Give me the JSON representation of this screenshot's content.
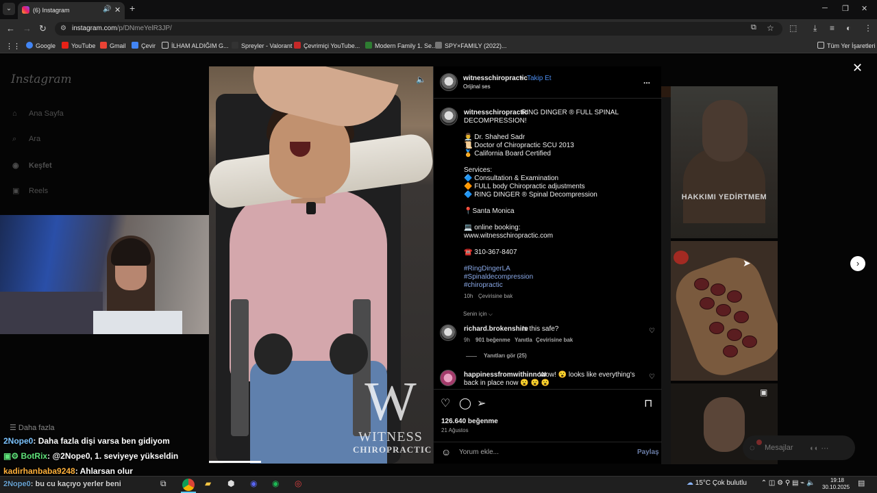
{
  "browser": {
    "tab_title": "(6) Instagram",
    "new_tab": "+",
    "url_host": "instagram.com",
    "url_path": "/p/DNmeYelR3JP/",
    "bookmarks": [
      "Google",
      "YouTube",
      "Gmail",
      "Çevir",
      "İLHAM ALDIĞIM G...",
      "Spreyler - Valorant",
      "Çevrimiçi YouTube...",
      "Modern Family 1. Se...",
      "SPY×FAMILY (2022)..."
    ],
    "all_bookmarks": "Tüm Yer İşaretleri"
  },
  "instagram": {
    "logo": "Instagram",
    "nav": [
      "Ana Sayfa",
      "Ara",
      "Keşfet",
      "Reels",
      "Mesajlar",
      "Daha fazla"
    ],
    "thumb_text": "HAKKIMI YEDİRTMEM",
    "messages": "Mesajlar"
  },
  "video": {
    "watermark_letter": "W",
    "watermark_l1": "WITNESS",
    "watermark_l2": "CHIROPRACTIC"
  },
  "post": {
    "username": "witnesschiropractic",
    "dot": "•",
    "follow": "Takip Et",
    "audio": "Orijinal ses",
    "more": "...",
    "caption_title": "RING DINGER ® FULL SPINAL",
    "caption_title2": "DECOMPRESSION!",
    "lines": [
      "👨‍⚕️ Dr. Shahed Sadr",
      "📜 Doctor of Chiropractic SCU 2013",
      "🏅 California Board Certified",
      "Services:",
      "🔷 Consultation & Examination",
      "🔶 FULL body Chiropractic adjustments",
      "🔷 RING DINGER ® Spinal Decompression",
      "📍Santa Monica",
      "💻 online booking:",
      "www.witnesschiropractic.com",
      "☎️ 310-367-8407"
    ],
    "hashtags": [
      "#RingDingerLA",
      "#Spinaldecompression",
      "#chiropractic"
    ],
    "caption_time": "10h",
    "caption_translate": "Çevirisine bak",
    "for_you": "Senin için ⌵",
    "comments": [
      {
        "user": "richard.brokenshire",
        "text": "Is this safe?",
        "time": "9h",
        "likes": "901 beğenme",
        "reply": "Yanıtla",
        "translate": "Çevirisine bak",
        "replies": "Yanıtları gör (25)"
      },
      {
        "user": "happinessfromwithinnow",
        "text": "Wow! 😮 looks like everything's",
        "text2": "back in place now 😮 😮 😮"
      }
    ],
    "likes": "126.640 beğenme",
    "date": "21 Ağustos",
    "comment_placeholder": "Yorum ekle...",
    "share": "Paylaş"
  },
  "chat": [
    {
      "user": "2Nope0",
      "msg": ": Daha fazla dişi varsa ben gidiyom",
      "color": "#7cc4ff"
    },
    {
      "user": "BotRix",
      "msg": ": @2Nope0, 1. seviyeye yükseldin",
      "color": "#5fe37a"
    },
    {
      "user": "kadirhanbaba9248",
      "msg": ": Ahlarsan olur",
      "color": "#ffb03a"
    },
    {
      "user": "2Nope0",
      "msg": ": bu cu kaçıyo yerler beni",
      "color": "#7cc4ff"
    }
  ],
  "taskbar": {
    "weather": "15°C  Çok bulutlu",
    "time": "19:18",
    "date": "30.10.2025"
  },
  "colors": {
    "accent": "#4d8ef0",
    "link": "#8aa9e8",
    "bg": "#000000"
  }
}
